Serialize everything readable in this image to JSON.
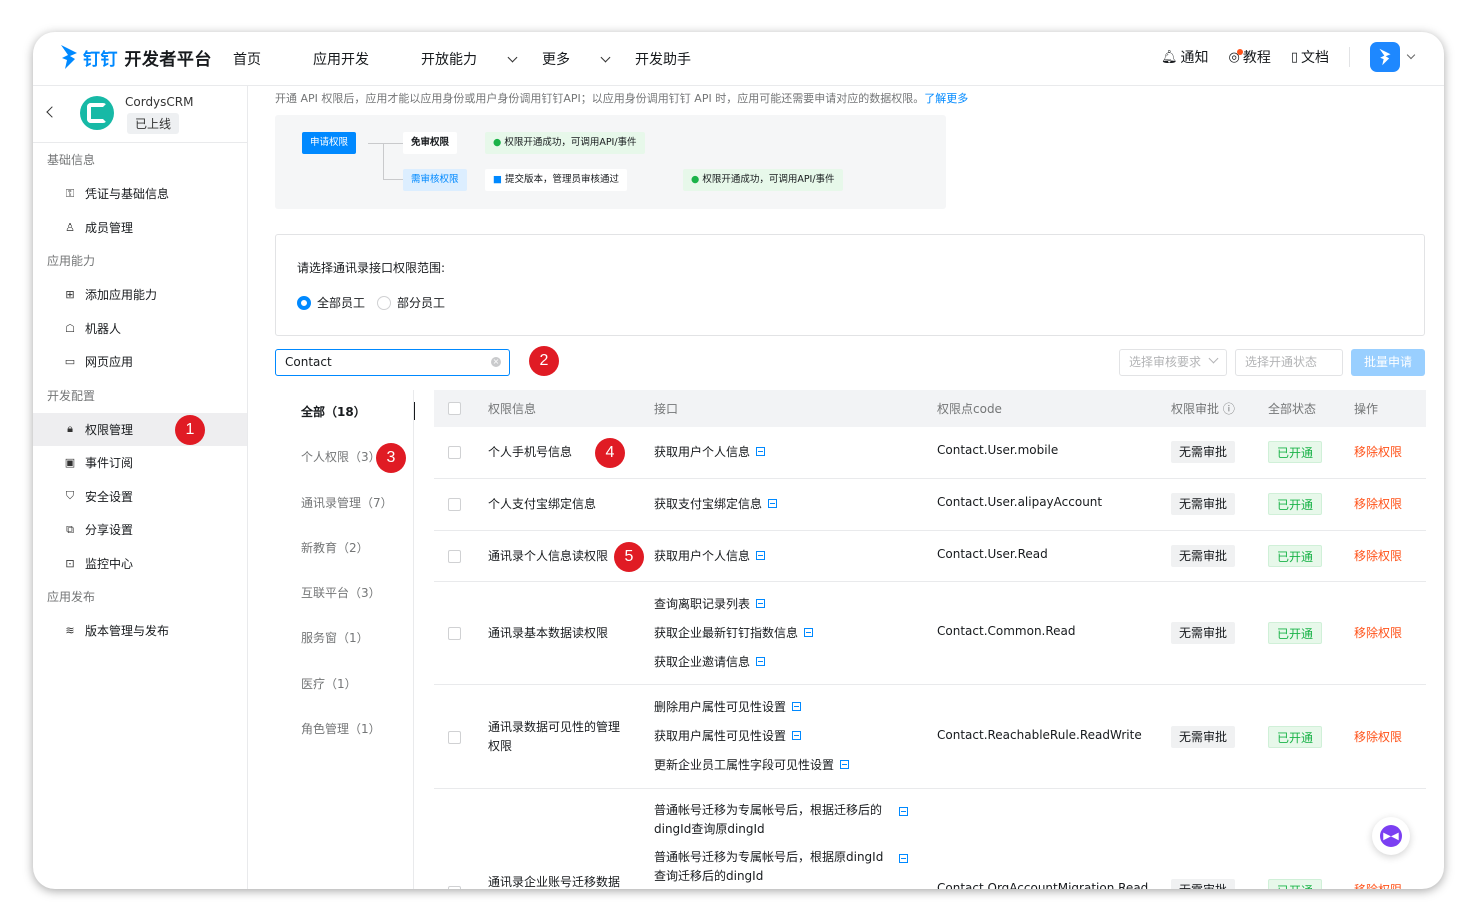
{
  "header": {
    "brand_prefix": "钉钉",
    "brand_suffix": "开发者平台",
    "nav": [
      {
        "label": "首页"
      },
      {
        "label": "应用开发"
      },
      {
        "label": "开放能力"
      },
      {
        "label": "更多"
      },
      {
        "label": "开发助手"
      }
    ],
    "notify_label": "通知",
    "tutorial_label": "教程",
    "docs_label": "文档"
  },
  "app": {
    "name": "CordysCRM",
    "status": "已上线"
  },
  "sidebar": {
    "sections": [
      {
        "title": "基础信息",
        "items": [
          {
            "label": "凭证与基础信息",
            "icon": "key-icon"
          },
          {
            "label": "成员管理",
            "icon": "user-icon"
          }
        ]
      },
      {
        "title": "应用能力",
        "items": [
          {
            "label": "添加应用能力",
            "icon": "apps-icon"
          },
          {
            "label": "机器人",
            "icon": "robot-icon"
          },
          {
            "label": "网页应用",
            "icon": "webpage-icon"
          }
        ]
      },
      {
        "title": "开发配置",
        "items": [
          {
            "label": "权限管理",
            "icon": "lock-icon"
          },
          {
            "label": "事件订阅",
            "icon": "event-icon"
          },
          {
            "label": "安全设置",
            "icon": "shield-icon"
          },
          {
            "label": "分享设置",
            "icon": "share-icon"
          },
          {
            "label": "监控中心",
            "icon": "monitor-icon"
          }
        ]
      },
      {
        "title": "应用发布",
        "items": [
          {
            "label": "版本管理与发布",
            "icon": "layers-icon"
          }
        ]
      }
    ]
  },
  "intro": {
    "text": "开通 API 权限后，应用才能以应用身份或用户身份调用钉钉API；以应用身份调用钉钉 API 时，应用可能还需要申请对应的数据权限。",
    "link": "了解更多"
  },
  "flow": {
    "apply": "申请权限",
    "free": "免审权限",
    "free_result": "权限开通成功，可调用API/事件",
    "review": "需审核权限",
    "review_step": "提交版本，管理员审核通过",
    "review_result": "权限开通成功，可调用API/事件"
  },
  "scope": {
    "question": "请选择通讯录接口权限范围:",
    "options": [
      "全部员工",
      "部分员工"
    ],
    "selected": "全部员工"
  },
  "search": {
    "value": "Contact"
  },
  "filters": {
    "review_placeholder": "选择审核要求",
    "status_placeholder": "选择开通状态",
    "batch_button": "批量申请"
  },
  "categories": [
    {
      "label": "全部（18）"
    },
    {
      "label": "个人权限（3）"
    },
    {
      "label": "通讯录管理（7）"
    },
    {
      "label": "新教育（2）"
    },
    {
      "label": "互联平台（3）"
    },
    {
      "label": "服务窗（1）"
    },
    {
      "label": "医疗（1）"
    },
    {
      "label": "角色管理（1）"
    }
  ],
  "table": {
    "headers": {
      "perm": "权限信息",
      "api": "接口",
      "code": "权限点code",
      "approval": "权限审批",
      "status": "全部状态",
      "op": "操作"
    },
    "rows": [
      {
        "perm": "个人手机号信息",
        "apis": [
          "获取用户个人信息"
        ],
        "code": "Contact.User.mobile",
        "approval": "无需审批",
        "status": "已开通",
        "op": "移除权限"
      },
      {
        "perm": "个人支付宝绑定信息",
        "apis": [
          "获取支付宝绑定信息"
        ],
        "code": "Contact.User.alipayAccount",
        "approval": "无需审批",
        "status": "已开通",
        "op": "移除权限"
      },
      {
        "perm": "通讯录个人信息读权限",
        "apis": [
          "获取用户个人信息"
        ],
        "code": "Contact.User.Read",
        "approval": "无需审批",
        "status": "已开通",
        "op": "移除权限"
      },
      {
        "perm": "通讯录基本数据读权限",
        "apis": [
          "查询离职记录列表",
          "获取企业最新钉钉指数信息",
          "获取企业邀请信息"
        ],
        "code": "Contact.Common.Read",
        "approval": "无需审批",
        "status": "已开通",
        "op": "移除权限"
      },
      {
        "perm": "通讯录数据可见性的管理权限",
        "apis": [
          "删除用户属性可见性设置",
          "获取用户属性可见性设置",
          "更新企业员工属性字段可见性设置"
        ],
        "code": "Contact.ReachableRule.ReadWrite",
        "approval": "无需审批",
        "status": "已开通",
        "op": "移除权限"
      },
      {
        "perm": "通讯录企业账号迁移数据",
        "apis": [
          "普通帐号迁移为专属帐号后，根据迁移后的dingId查询原dingId",
          "普通帐号迁移为专属帐号后，根据原dingId查询迁移后的dingId"
        ],
        "code": "Contact.OrgAccountMigration.Read",
        "approval": "无需审批",
        "status": "已开通",
        "op": "移除权限"
      }
    ]
  },
  "markers": [
    "1",
    "2",
    "3",
    "4",
    "5"
  ],
  "colors": {
    "accent": "#0089ff",
    "danger": "#ff5219",
    "success": "#1bb349",
    "marker": "#e01b24"
  }
}
